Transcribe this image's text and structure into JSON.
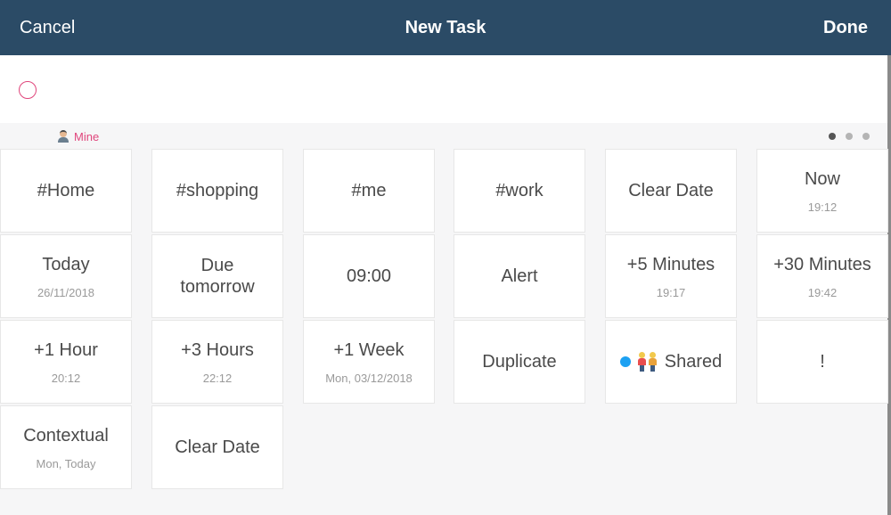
{
  "navbar": {
    "cancel": "Cancel",
    "title": "New Task",
    "done": "Done"
  },
  "task": {
    "value": "",
    "placeholder": ""
  },
  "list": {
    "name": "Mine"
  },
  "pager": {
    "pages": 3,
    "active": 0
  },
  "tiles": [
    {
      "label": "#Home",
      "sub": "",
      "icon": ""
    },
    {
      "label": "#shopping",
      "sub": "",
      "icon": ""
    },
    {
      "label": "#me",
      "sub": "",
      "icon": ""
    },
    {
      "label": "#work",
      "sub": "",
      "icon": ""
    },
    {
      "label": "Clear Date",
      "sub": "",
      "icon": ""
    },
    {
      "label": "Now",
      "sub": "19:12",
      "icon": ""
    },
    {
      "label": "Today",
      "sub": "26/11/2018",
      "icon": ""
    },
    {
      "label": "Due tomorrow",
      "sub": "",
      "icon": ""
    },
    {
      "label": "09:00",
      "sub": "",
      "icon": ""
    },
    {
      "label": "Alert",
      "sub": "",
      "icon": ""
    },
    {
      "label": "+5 Minutes",
      "sub": "19:17",
      "icon": ""
    },
    {
      "label": "+30 Minutes",
      "sub": "19:42",
      "icon": ""
    },
    {
      "label": "+1 Hour",
      "sub": "20:12",
      "icon": ""
    },
    {
      "label": "+3 Hours",
      "sub": "22:12",
      "icon": ""
    },
    {
      "label": "+1 Week",
      "sub": "Mon, 03/12/2018",
      "icon": ""
    },
    {
      "label": "Duplicate",
      "sub": "",
      "icon": ""
    },
    {
      "label": "Shared",
      "sub": "",
      "icon": "shared"
    },
    {
      "label": "!",
      "sub": "",
      "icon": ""
    },
    {
      "label": "Contextual",
      "sub": "Mon, Today",
      "icon": ""
    },
    {
      "label": "Clear Date",
      "sub": "",
      "icon": ""
    }
  ],
  "colors": {
    "navbar": "#2b4b66",
    "accent": "#e0467c",
    "shared_dot": "#1da1f2"
  },
  "icons": {
    "list": "person-icon",
    "shared": "couple-icon"
  }
}
